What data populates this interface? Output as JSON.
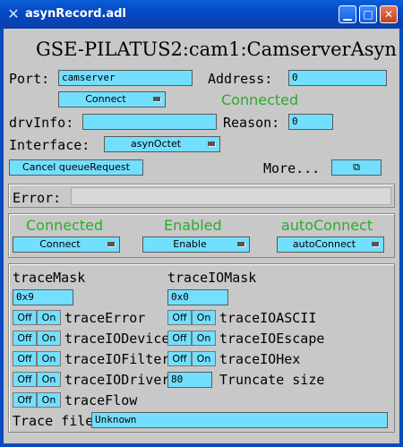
{
  "window": {
    "title": "asynRecord.adl",
    "icon": "x-icon"
  },
  "header": {
    "record_name": "GSE-PILATUS2:cam1:CamserverAsyn"
  },
  "port": {
    "label": "Port:",
    "value": "camserver"
  },
  "address": {
    "label": "Address:",
    "value": "0"
  },
  "connect_menu": {
    "value": "Connect"
  },
  "connection_status": "Connected",
  "drvinfo": {
    "label": "drvInfo:",
    "value": ""
  },
  "reason": {
    "label": "Reason:",
    "value": "0"
  },
  "interface": {
    "label": "Interface:",
    "value": "asynOctet"
  },
  "cancel_button": "Cancel queueRequest",
  "more": {
    "label": "More...",
    "icon": "windows-icon"
  },
  "error": {
    "label": "Error:",
    "value": ""
  },
  "status_panel": {
    "connected": {
      "status": "Connected",
      "menu": "Connect"
    },
    "enabled": {
      "status": "Enabled",
      "menu": "Enable"
    },
    "autoconnect": {
      "status": "autoConnect",
      "menu": "autoConnect"
    }
  },
  "trace": {
    "mask_label": "traceMask",
    "mask_value": "0x9",
    "io_mask_label": "traceIOMask",
    "io_mask_value": "0x0",
    "off_label": "Off",
    "on_label": "On",
    "left_items": [
      "traceError",
      "traceIODevice",
      "traceIOFilter",
      "traceIODriver",
      "traceFlow"
    ],
    "right_items": [
      "traceIOASCII",
      "traceIOEscape",
      "traceIOHex"
    ],
    "truncate_value": "80",
    "truncate_label": "Truncate size",
    "file_label": "Trace file:",
    "file_value": "Unknown"
  },
  "colors": {
    "field": "#73dfff",
    "status_green": "#2faa2f",
    "titlebar": "#0549c4"
  }
}
